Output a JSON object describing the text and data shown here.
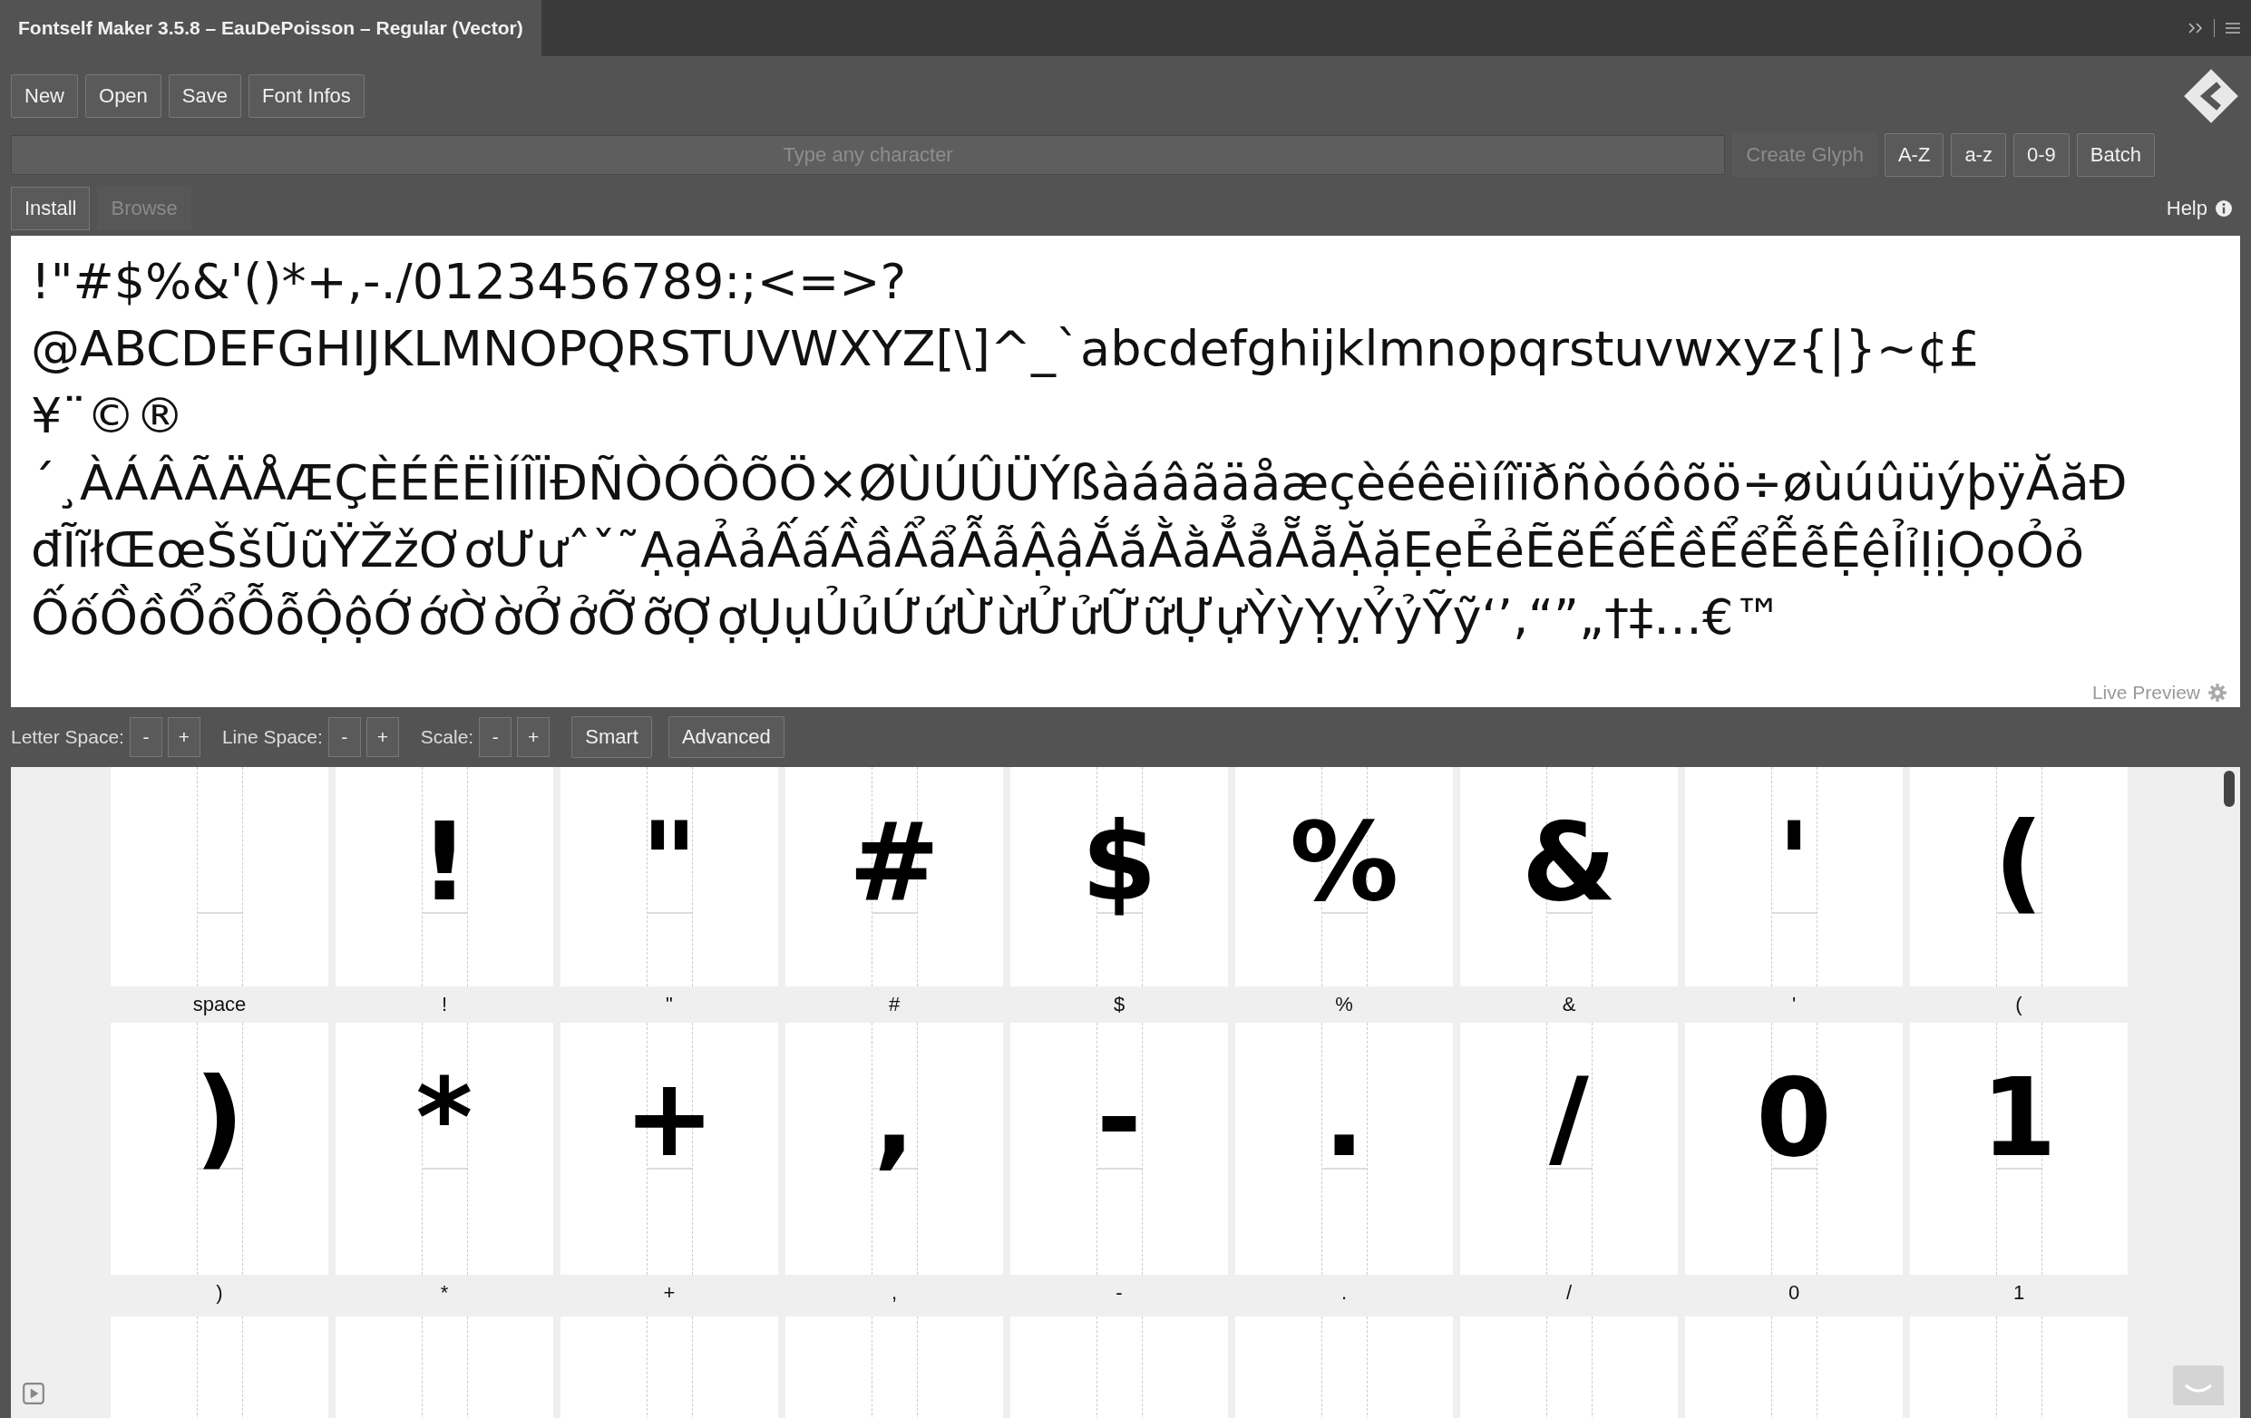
{
  "window": {
    "title": "Fontself Maker 3.5.8 – EauDePoisson – Regular (Vector)"
  },
  "file_buttons": [
    "New",
    "Open",
    "Save",
    "Font Infos"
  ],
  "glyph_input": {
    "placeholder": "Type any character"
  },
  "create_button": {
    "label": "Create Glyph",
    "disabled": true
  },
  "range_buttons": [
    "A-Z",
    "a-z",
    "0-9",
    "Batch"
  ],
  "tabs": [
    {
      "label": "Install",
      "selected": true
    },
    {
      "label": "Browse",
      "selected": false
    }
  ],
  "help": "Help",
  "preview": {
    "lines": [
      "!\"#$%&'()*+,-./0123456789:;<=>?",
      "@ABCDEFGHIJKLMNOPQRSTUVWXYZ[\\]^_`abcdefghijklmnopqrstuvwxyz{|}~¢£",
      "¥¨©®",
      "´¸ÀÁÂÃÄÅÆÇÈÉÊËÌÍÎÏÐÑÒÓÔÕÖ×ØÙÚÛÜÝßàáâãäåæçèéêëìíîïðñòóôõö÷øùúûüýþÿĂăĐ",
      "đĨĩłŒœŠšŨũŸŽžƠơƯưˆˇ˜ẠạẢảẤấẦầẨẩẪẫẬậẮắẰằẲẳẴẵẶặẸẹẺẻẼẽẾếỀềỂểỄễỆệỈỉỊịỌọỎỏ",
      "ỐốỒồỔổỖỗỘộỚớỜờỞởỠỡỢợỤụỦủỨứỪừỬửỮữỰựỲỳỴỵỶỷỸỹ‘’‚“”„†‡…€™"
    ],
    "caption": "Live Preview"
  },
  "spacing_controls": [
    {
      "label": "Letter Space:",
      "minus": "-",
      "plus": "+"
    },
    {
      "label": "Line Space:",
      "minus": "-",
      "plus": "+"
    },
    {
      "label": "Scale:",
      "minus": "-",
      "plus": "+"
    }
  ],
  "mode_buttons": [
    "Smart",
    "Advanced"
  ],
  "glyphs": [
    {
      "label": "space"
    },
    {
      "glyph": "!",
      "label": "!"
    },
    {
      "glyph": "\"",
      "label": "\""
    },
    {
      "glyph": "#",
      "label": "#"
    },
    {
      "glyph": "$",
      "label": "$"
    },
    {
      "glyph": "%",
      "label": "%"
    },
    {
      "glyph": "&",
      "label": "&"
    },
    {
      "glyph": "'",
      "label": "'"
    },
    {
      "glyph": "(",
      "label": "("
    },
    {
      "glyph": ")",
      "label": ")"
    },
    {
      "glyph": "*",
      "label": "*"
    },
    {
      "glyph": "+",
      "label": "+"
    },
    {
      "glyph": ",",
      "label": ","
    },
    {
      "glyph": "-",
      "label": "-"
    },
    {
      "glyph": ".",
      "label": "."
    },
    {
      "glyph": "/",
      "label": "/"
    },
    {
      "glyph": "0",
      "label": "0"
    },
    {
      "glyph": "1",
      "label": "1"
    }
  ]
}
